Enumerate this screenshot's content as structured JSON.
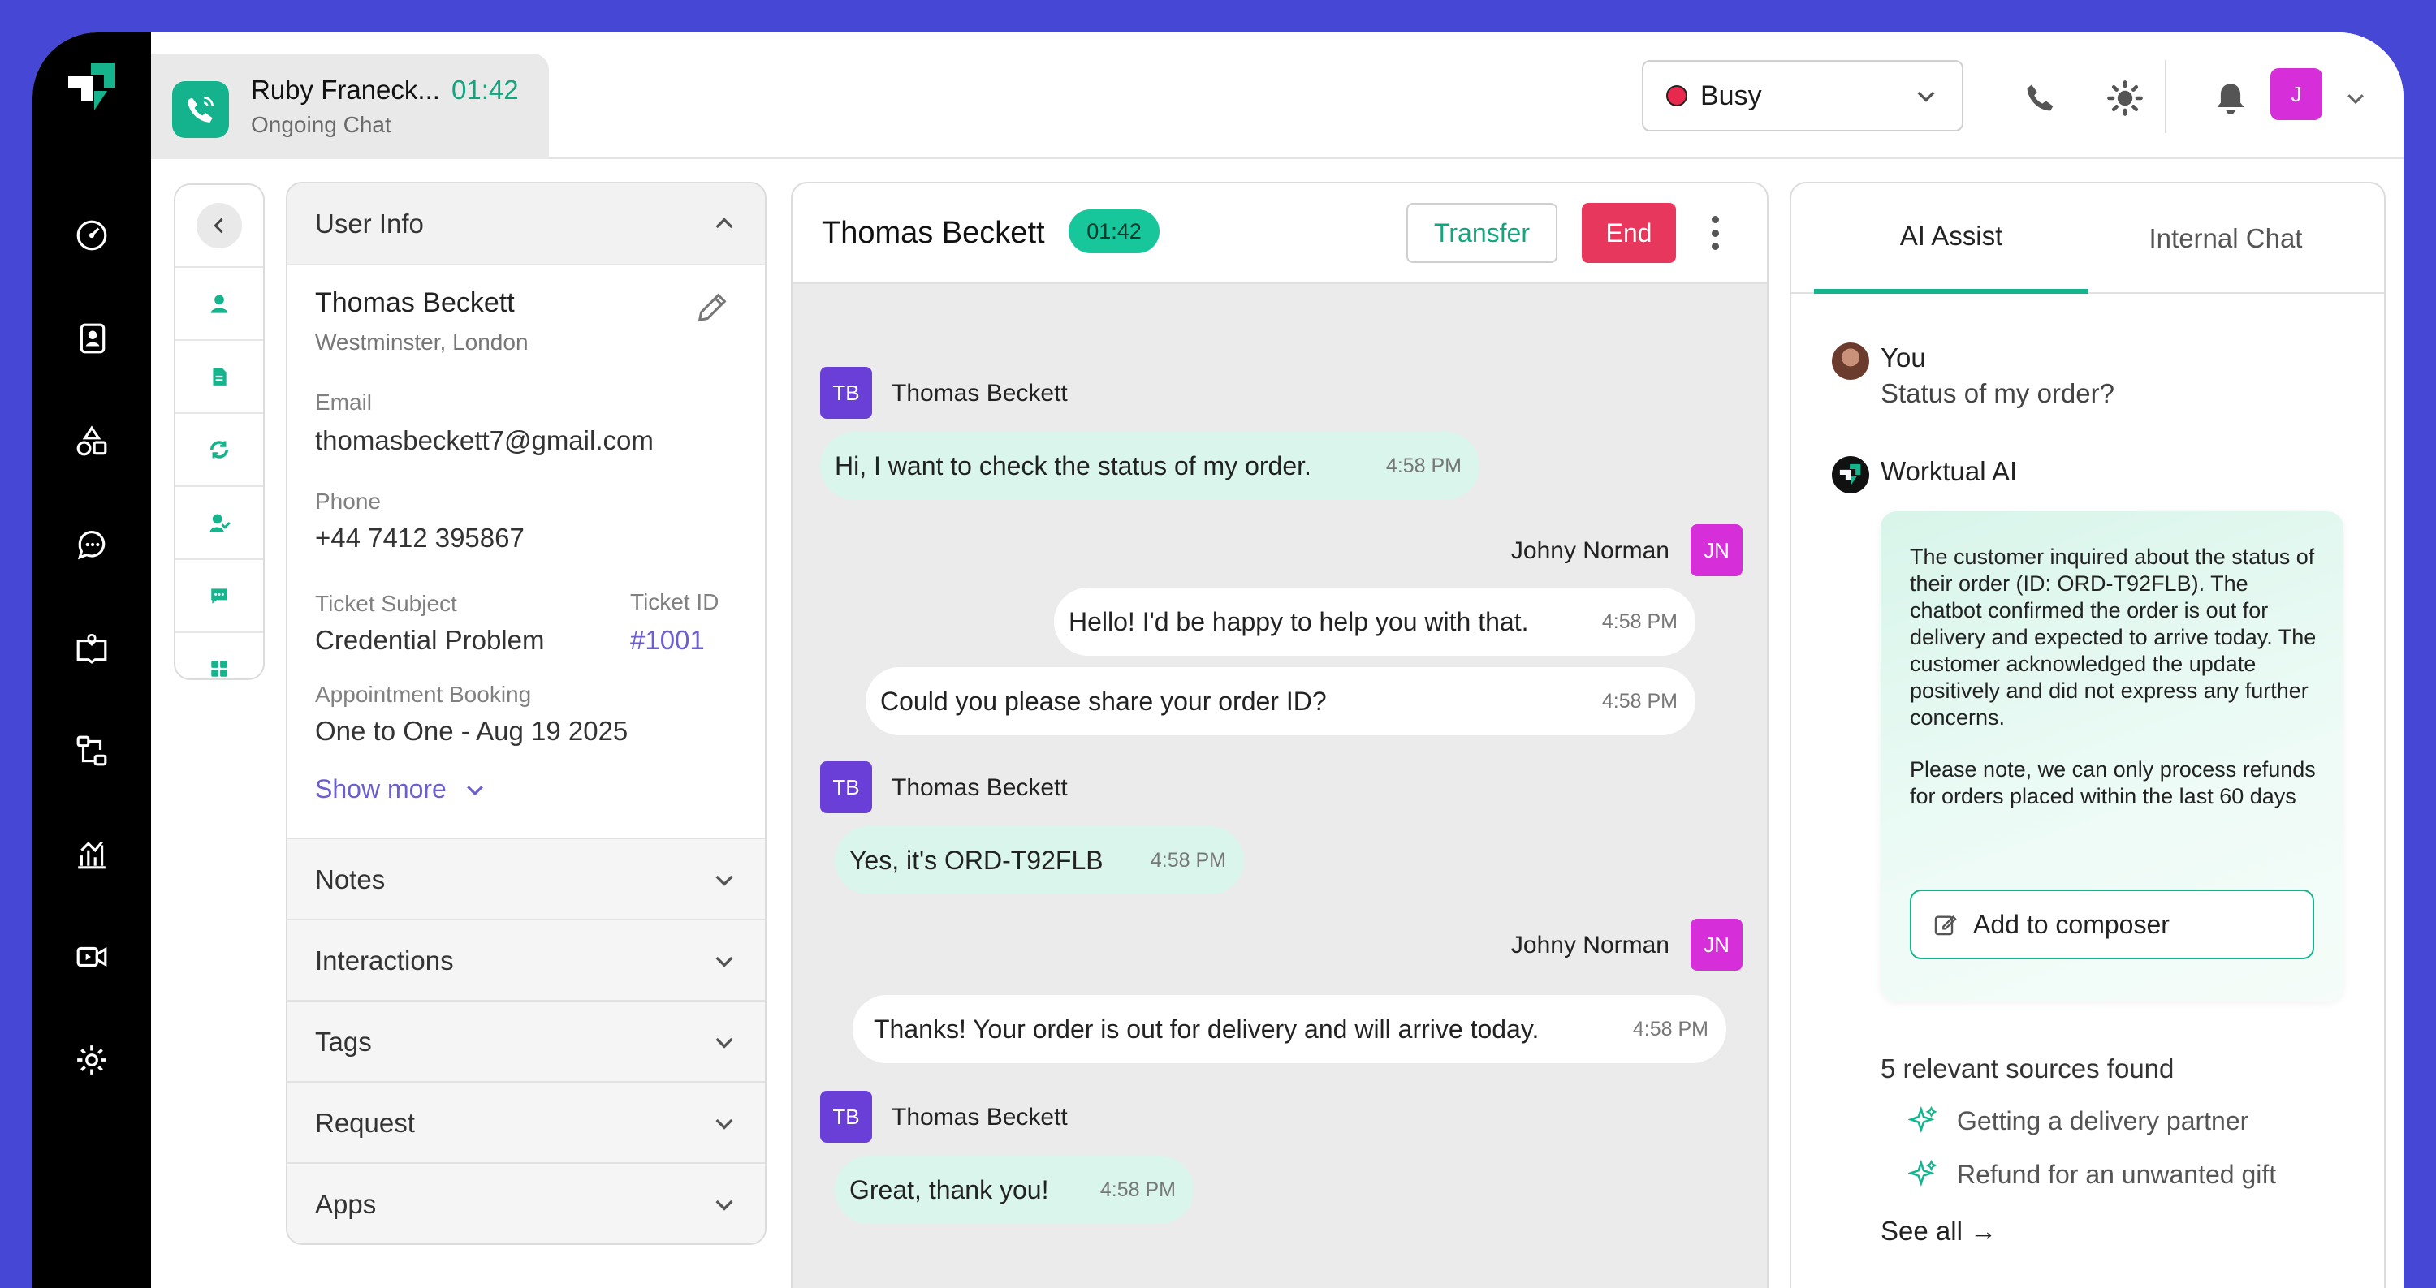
{
  "colors": {
    "frame": "#4747d6",
    "accent": "#14b38d",
    "end_button": "#e8375c",
    "busy_dot": "#e8284c",
    "avatar_tb": "#6a3fd8",
    "avatar_jn": "#d62fd9",
    "link": "#6b5fcf"
  },
  "rail": {
    "icons": [
      "logo-icon",
      "dashboard-gauge-icon",
      "contacts-icon",
      "shapes-icon",
      "chat-bubble-icon",
      "knowledge-book-icon",
      "workflow-icon",
      "analytics-icon",
      "video-icon",
      "settings-gear-icon"
    ]
  },
  "topbar": {
    "active_chat": {
      "name": "Ruby Franeck...",
      "timer": "01:42",
      "status": "Ongoing Chat"
    },
    "agent_status": "Busy",
    "avatar_initial": "J"
  },
  "user_info": {
    "title": "User Info",
    "name": "Thomas Beckett",
    "location": "Westminster, London",
    "email_label": "Email",
    "email": "thomasbeckett7@gmail.com",
    "phone_label": "Phone",
    "phone": "+44 7412 395867",
    "ticket_subject_label": "Ticket Subject",
    "ticket_subject": "Credential Problem",
    "ticket_id_label": "Ticket ID",
    "ticket_id": "#1001",
    "appointment_label": "Appointment Booking",
    "appointment": "One to One - Aug 19 2025",
    "show_more": "Show more",
    "sections": [
      "Notes",
      "Interactions",
      "Tags",
      "Request",
      "Apps"
    ]
  },
  "chat": {
    "contact_name": "Thomas Beckett",
    "timer": "01:42",
    "transfer_label": "Transfer",
    "end_label": "End",
    "messages": [
      {
        "sender": "Thomas Beckett",
        "initials": "TB",
        "text": "Hi, I want to check the status of my order.",
        "time": "4:58 PM"
      },
      {
        "sender": "Johny Norman",
        "initials": "JN",
        "text": "Hello! I'd be happy to help you with that.",
        "time": "4:58 PM"
      },
      {
        "sender": "Johny Norman",
        "initials": "JN",
        "text": "Could you please share your order ID?",
        "time": "4:58 PM"
      },
      {
        "sender": "Thomas Beckett",
        "initials": "TB",
        "text": "Yes, it's ORD-T92FLB",
        "time": "4:58 PM"
      },
      {
        "sender": "Johny Norman",
        "initials": "JN",
        "text": "Thanks! Your order is out for delivery and will arrive today.",
        "time": "4:58 PM"
      },
      {
        "sender": "Thomas Beckett",
        "initials": "TB",
        "text": "Great, thank you!",
        "time": "4:58 PM"
      }
    ]
  },
  "ai_assist": {
    "tabs": [
      "AI Assist",
      "Internal Chat"
    ],
    "you_label": "You",
    "you_question": "Status of my order?",
    "ai_label": "Worktual AI",
    "summary": "The customer inquired about the status of their order (ID: ORD-T92FLB). The chatbot confirmed the order is out for delivery and expected to arrive today. The customer acknowledged the update positively and did not express any further concerns.",
    "note": "Please note, we can only process refunds for orders placed within the last 60 days",
    "add_to_composer": "Add to composer",
    "sources_title": "5 relevant sources found",
    "sources": [
      "Getting a delivery partner",
      "Refund for an unwanted gift"
    ],
    "see_all": "See all →"
  }
}
